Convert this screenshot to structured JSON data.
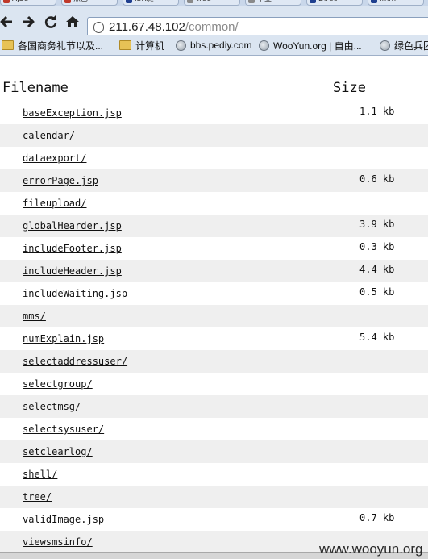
{
  "browser": {
    "tabs": [
      {
        "label": "AJSe",
        "color": "#c0392b"
      },
      {
        "label": "黑巴",
        "color": "#c0392b"
      },
      {
        "label": "ISR斑",
        "color": "#1f3f8f"
      },
      {
        "label": "Tree",
        "color": "#8a8a8a"
      },
      {
        "label": "下登",
        "color": "#8a8a8a"
      },
      {
        "label": "Direc",
        "color": "#1f3f8f"
      },
      {
        "label": "Imm",
        "color": "#1f3f8f"
      }
    ],
    "nav_icons": {
      "back": "back-arrow-icon",
      "forward": "forward-arrow-icon",
      "reload": "reload-icon",
      "home": "home-icon"
    },
    "address": {
      "host": "211.67.48.102",
      "path": "/common/"
    },
    "bookmarks": [
      {
        "label": "各国商务礼节以及...",
        "icon": "folder-icon"
      },
      {
        "label": "计算机",
        "icon": "folder-icon"
      },
      {
        "label": "bbs.pediy.com",
        "icon": "globe-icon"
      },
      {
        "label": "WooYun.org | 自由...",
        "icon": "globe-icon"
      },
      {
        "label": "绿色兵团",
        "icon": "globe-icon"
      }
    ]
  },
  "listing": {
    "headers": {
      "name": "Filename",
      "size": "Size"
    },
    "rows": [
      {
        "name": "baseException.jsp",
        "size": "1.1 kb"
      },
      {
        "name": "calendar/",
        "size": ""
      },
      {
        "name": "dataexport/",
        "size": ""
      },
      {
        "name": "errorPage.jsp",
        "size": "0.6 kb"
      },
      {
        "name": "fileupload/",
        "size": ""
      },
      {
        "name": "globalHearder.jsp",
        "size": "3.9 kb"
      },
      {
        "name": "includeFooter.jsp",
        "size": "0.3 kb"
      },
      {
        "name": "includeHeader.jsp",
        "size": "4.4 kb"
      },
      {
        "name": "includeWaiting.jsp",
        "size": "0.5 kb"
      },
      {
        "name": "mms/",
        "size": ""
      },
      {
        "name": "numExplain.jsp",
        "size": "5.4 kb"
      },
      {
        "name": "selectaddressuser/",
        "size": ""
      },
      {
        "name": "selectgroup/",
        "size": ""
      },
      {
        "name": "selectmsg/",
        "size": ""
      },
      {
        "name": "selectsysuser/",
        "size": ""
      },
      {
        "name": "setclearlog/",
        "size": ""
      },
      {
        "name": "shell/",
        "size": ""
      },
      {
        "name": "tree/",
        "size": ""
      },
      {
        "name": "validImage.jsp",
        "size": "0.7 kb"
      },
      {
        "name": "viewsmsinfo/",
        "size": ""
      }
    ]
  },
  "watermark": "www.wooyun.org",
  "colors": {
    "row_alt": "#efefef",
    "chrome": "#dbe5f1",
    "url_path": "#8a8a8a"
  }
}
